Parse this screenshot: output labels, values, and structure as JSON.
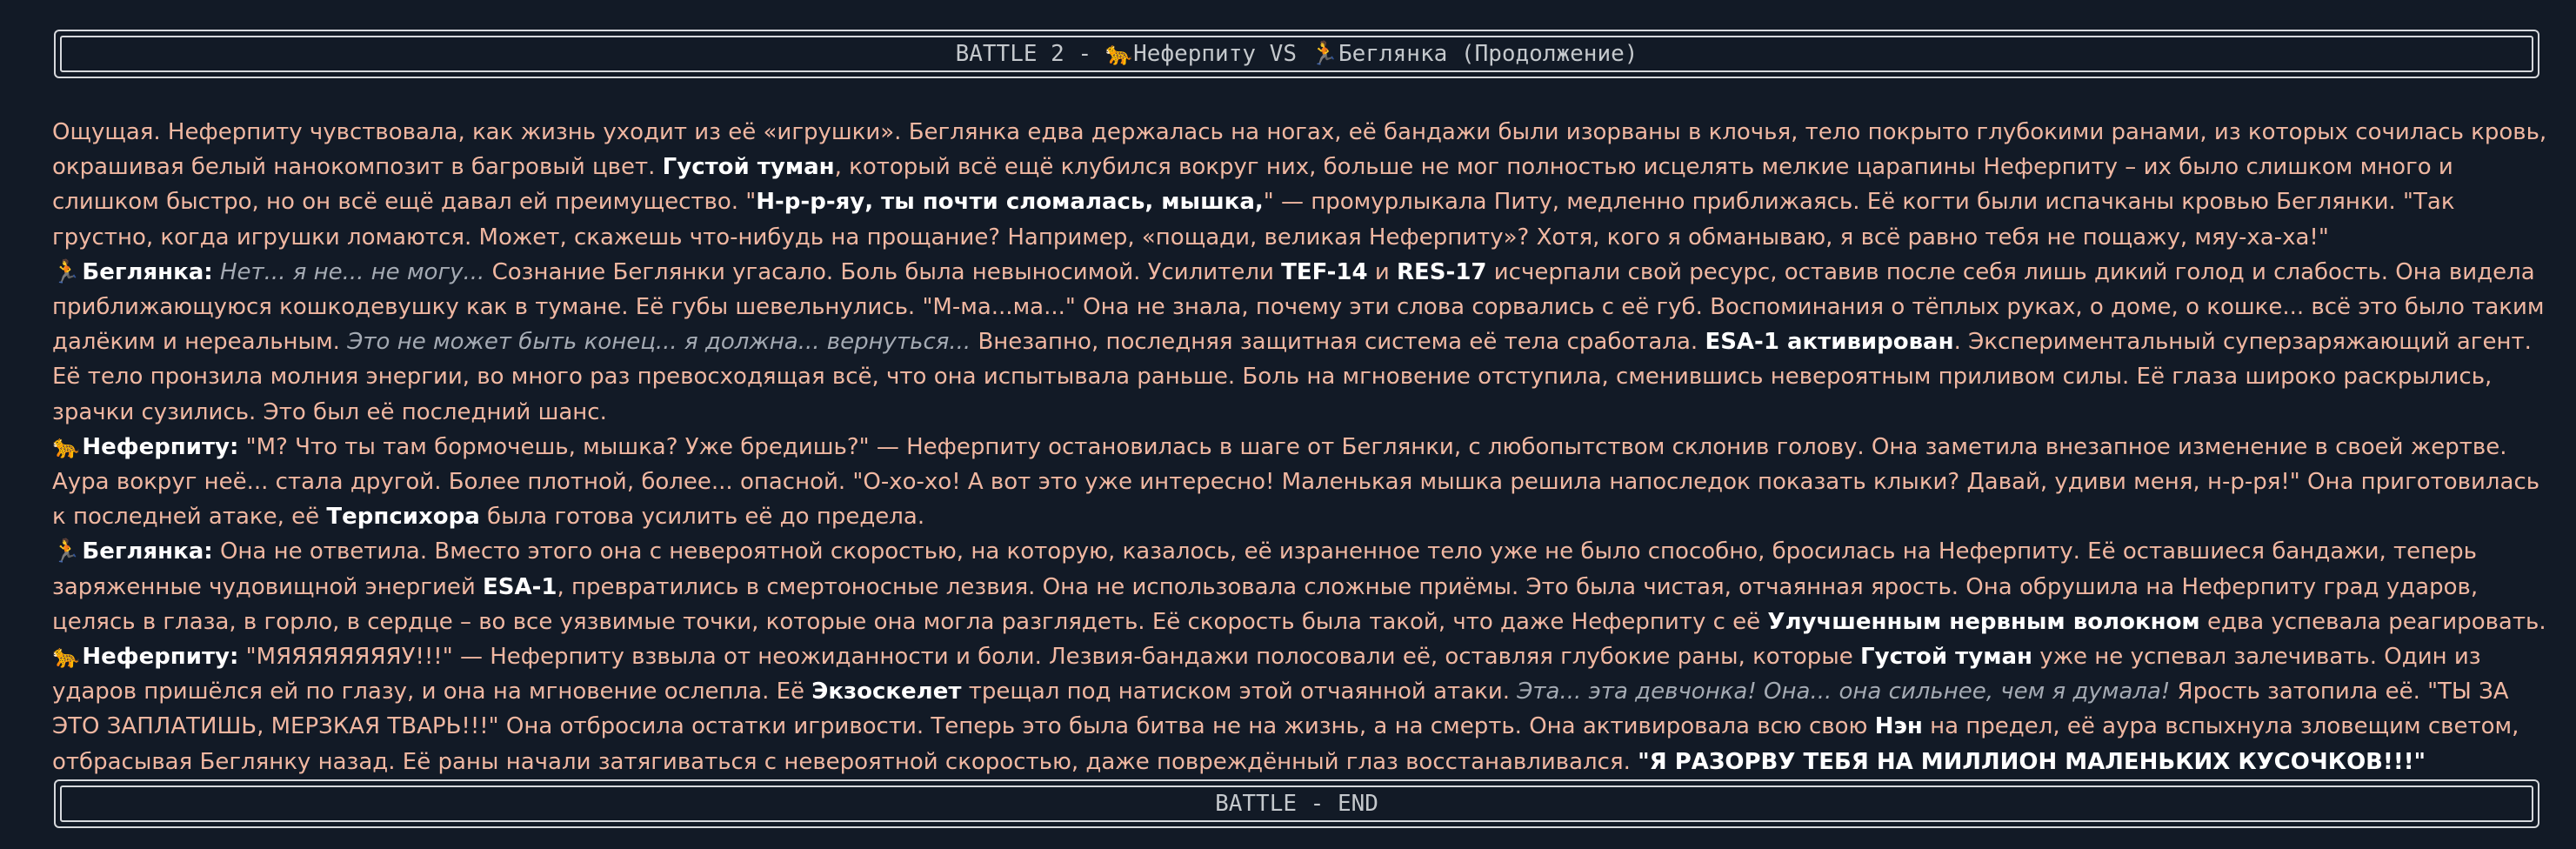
{
  "header": {
    "title_prefix": "BATTLE 2 - ",
    "icon_a": "🐆",
    "name_a": "Неферпиту",
    "vs": " VS ",
    "icon_b": "🏃",
    "name_b": "Беглянка",
    "suffix": " (Продолжение)"
  },
  "footer": {
    "title": "BATTLE - END"
  },
  "colors": {
    "background": "#121a26",
    "narration": "#f0b7a1",
    "emphasis": "#ffffff",
    "thought": "#a4aab3",
    "frame": "#d6d8dc"
  },
  "p1": {
    "t1": "Ощущая. Неферпиту чувствовала, как жизнь уходит из её «игрушки». Беглянка едва держалась на ногах, её бандажи были изорваны в клочья, тело покрыто глубокими ранами, из которых сочилась кровь, окрашивая белый нанокомпозит в багровый цвет. ",
    "b1": "Густой туман",
    "t2": ", который всё ещё клубился вокруг них, больше не мог полностью исцелять мелкие царапины Неферпиту – их было слишком много и слишком быстро, но он всё ещё давал ей преимущество. \"",
    "b2": "Н-р-р-яу, ты почти сломалась, мышка,",
    "t3": "\" — промурлыкала Питу, медленно приближаясь. Её когти были испачканы кровью Беглянки. \"Так грустно, когда игрушки ломаются. Может, скажешь что-нибудь на прощание? Например, «пощади, великая Неферпиту»? Хотя, кого я обманываю, я всё равно тебя не пощажу, мяу-ха-ха!\""
  },
  "p2": {
    "icon": "🏃",
    "speaker": "Беглянка:",
    "i1": " Нет... я не... не могу...",
    "t1": " Сознание Беглянки угасало. Боль была невыносимой. Усилители ",
    "b1": "TEF-14",
    "t2": " и ",
    "b2": "RES-17",
    "t3": " исчерпали свой ресурс, оставив после себя лишь дикий голод и слабость. Она видела приближающуюся кошкодевушку как в тумане. Её губы шевельнулись. \"М-ма...ма...\" Она не знала, почему эти слова сорвались с её губ. Воспоминания о тёплых руках, о доме, о кошке... всё это было таким далёким и нереальным. ",
    "i2": "Это не может быть конец... я должна... вернуться...",
    "t4": " Внезапно, последняя защитная система её тела сработала. ",
    "b3": "ESA-1 активирован",
    "t5": ". Экспериментальный суперзаряжающий агент. Её тело пронзила молния энергии, во много раз превосходящая всё, что она испытывала раньше. Боль на мгновение отступила, сменившись невероятным приливом силы. Её глаза широко раскрылись, зрачки сузились. Это был её последний шанс."
  },
  "p3": {
    "icon": "🐆",
    "speaker": "Неферпиту:",
    "t1": " \"М? Что ты там бормочешь, мышка? Уже бредишь?\" — Неферпиту остановилась в шаге от Беглянки, с любопытством склонив голову. Она заметила внезапное изменение в своей жертве. Аура вокруг неё... стала другой. Более плотной, более... опасной. \"О-хо-хо! А вот это уже интересно! Маленькая мышка решила напоследок показать клыки? Давай, удиви меня, н-р-ря!\" Она приготовилась к последней атаке, её ",
    "b1": "Терпсихора",
    "t2": " была готова усилить её до предела."
  },
  "p4": {
    "icon": "🏃",
    "speaker": "Беглянка:",
    "t1": " Она не ответила. Вместо этого она с невероятной скоростью, на которую, казалось, её израненное тело уже не было способно, бросилась на Неферпиту. Её оставшиеся бандажи, теперь заряженные чудовищной энергией ",
    "b1": "ESA-1",
    "t2": ", превратились в смертоносные лезвия. Она не использовала сложные приёмы. Это была чистая, отчаянная ярость. Она обрушила на Неферпиту град ударов, целясь в глаза, в горло, в сердце – во все уязвимые точки, которые она могла разглядеть. Её скорость была такой, что даже Неферпиту с её ",
    "b2": "Улучшенным нервным волокном",
    "t3": " едва успевала реагировать."
  },
  "p5": {
    "icon": "🐆",
    "speaker": "Неферпиту:",
    "t1": " \"МЯЯЯЯЯЯЯЯУ!!!\" — Неферпиту взвыла от неожиданности и боли. Лезвия-бандажи полосовали её, оставляя глубокие раны, которые ",
    "b1": "Густой туман",
    "t2": " уже не успевал залечивать. Один из ударов пришёлся ей по глазу, и она на мгновение ослепла. Её ",
    "b2": "Экзоскелет",
    "t3": " трещал под натиском этой отчаянной атаки. ",
    "i1": "Эта... эта девчонка! Она... она сильнее, чем я думала!",
    "t4": " Ярость затопила её. \"ТЫ ЗА ЭТО ЗАПЛАТИШЬ, МЕРЗКАЯ ТВАРЬ!!!\" Она отбросила остатки игривости. Теперь это была битва не на жизнь, а на смерть. Она активировала всю свою ",
    "b3": "Нэн",
    "t5": " на предел, её аура вспыхнула зловещим светом, отбрасывая Беглянку назад. Её раны начали затягиваться с невероятной скоростью, даже повреждённый глаз восстанавливался. ",
    "b4": "\"Я РАЗОРВУ ТЕБЯ НА МИЛЛИОН МАЛЕНЬКИХ КУСОЧКОВ!!!\""
  }
}
